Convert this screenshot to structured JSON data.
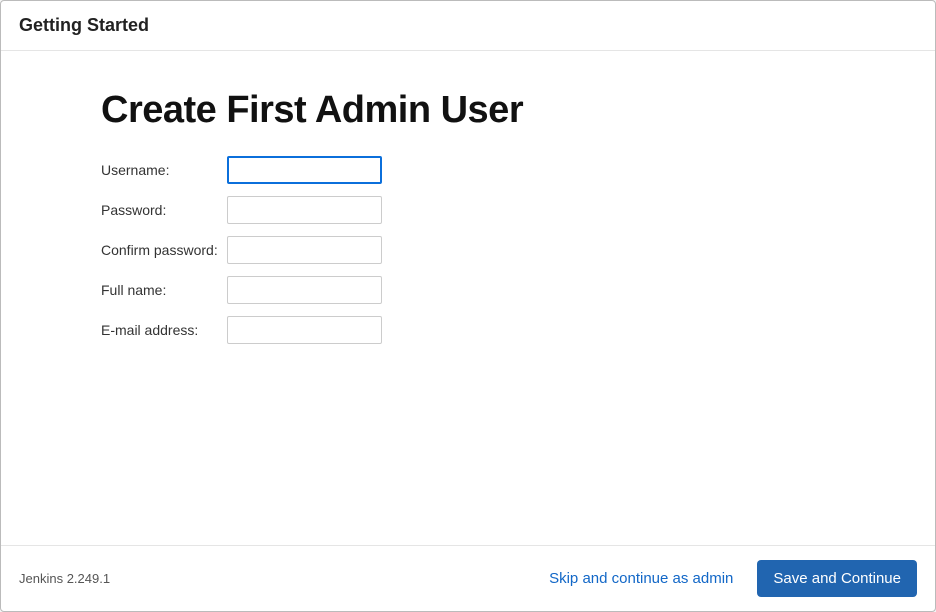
{
  "header": {
    "title": "Getting Started"
  },
  "main": {
    "title": "Create First Admin User",
    "fields": {
      "username": {
        "label": "Username:",
        "value": ""
      },
      "password": {
        "label": "Password:",
        "value": ""
      },
      "confirm_password": {
        "label": "Confirm password:",
        "value": ""
      },
      "full_name": {
        "label": "Full name:",
        "value": ""
      },
      "email": {
        "label": "E-mail address:",
        "value": ""
      }
    }
  },
  "footer": {
    "version": "Jenkins 2.249.1",
    "skip_label": "Skip and continue as admin",
    "save_label": "Save and Continue"
  }
}
